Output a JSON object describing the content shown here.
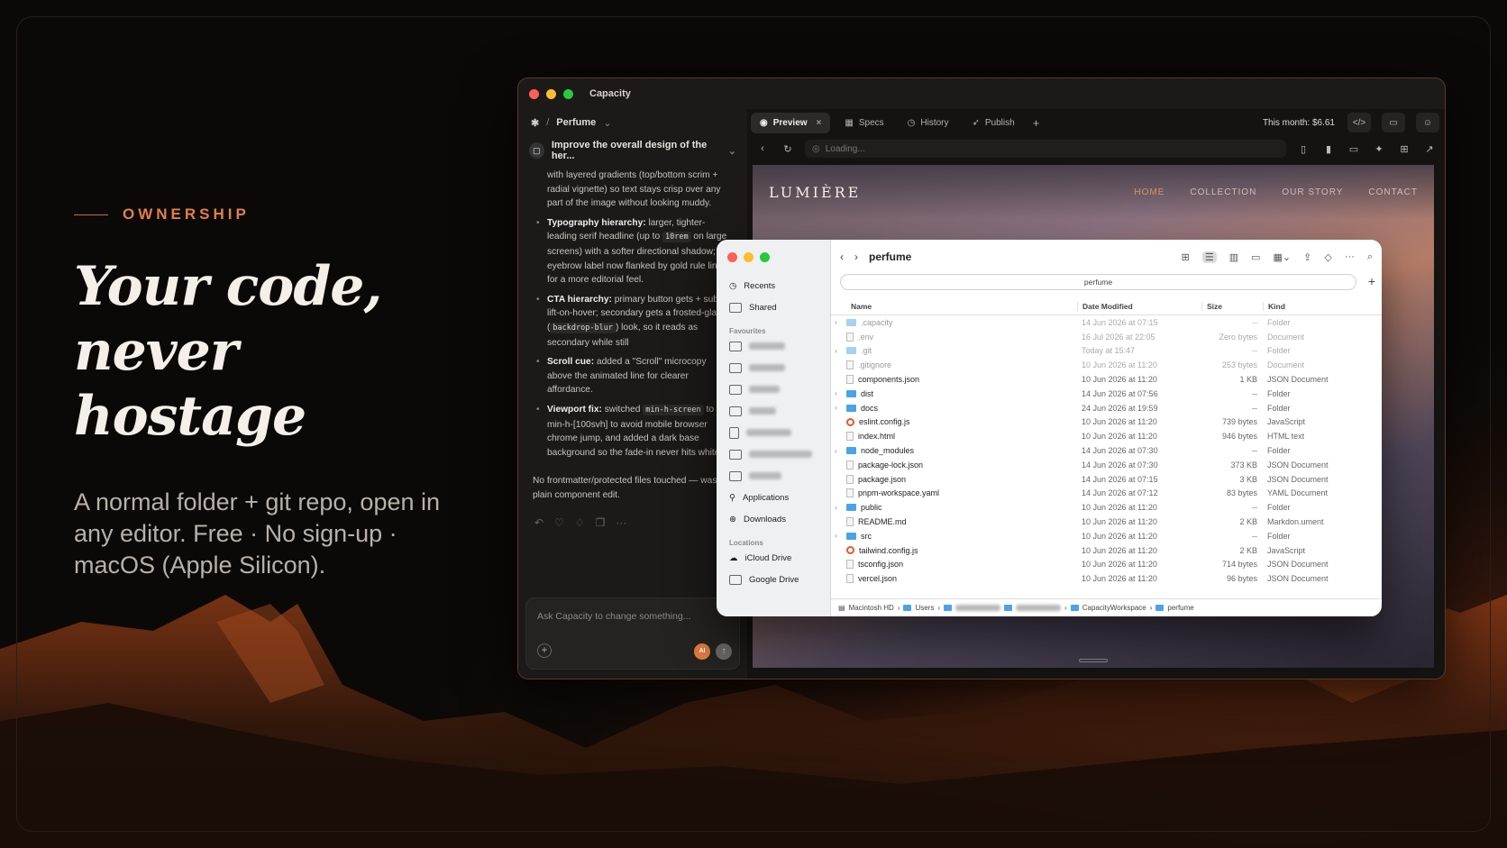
{
  "hero": {
    "eyebrow": "OWNERSHIP",
    "headline_1": "Your code,",
    "headline_2": "never hostage",
    "subtitle": "A normal folder + git repo, open in any editor. Free · No sign-up · macOS (Apple Silicon)."
  },
  "app": {
    "title": "Capacity",
    "project_sep": "/",
    "project": "Perfume",
    "thread_title": "Improve the overall design of the her...",
    "msg_intro": "with layered gradients (top/bottom scrim + radial vignette) so text stays crisp over any part of the image without looking muddy.",
    "bullets": [
      {
        "bold": "Typography hierarchy:",
        "a": " larger, tighter-leading serif headline (up to ",
        "code": "10rem",
        "b": " on large screens) with a softer directional shadow; eyebrow label now flanked by gold rule lines for a more editorial feel."
      },
      {
        "bold": "CTA hierarchy:",
        "a": " primary button gets + subtle lift-on-hover; secondary gets a frosted-glass (",
        "code": "backdrop-blur",
        "b": ") look, so it reads as secondary while still"
      },
      {
        "bold": "Scroll cue:",
        "a": " added a \"Scroll\" microcopy above the animated line for clearer affordance.",
        "code": "",
        "b": ""
      },
      {
        "bold": "Viewport fix:",
        "a": " switched ",
        "code": "min-h-screen",
        "b": " to min-h-[100svh] to avoid mobile browser chrome jump, and added a dark base background so the fade-in never hits white."
      }
    ],
    "footer_note": "No frontmatter/protected files touched — was a plain component edit.",
    "composer_placeholder": "Ask Capacity to change something...",
    "ai_badge": "AI",
    "tabs": [
      "Preview",
      "Specs",
      "History",
      "Publish"
    ],
    "cost": "This month: $6.61",
    "url_placeholder": "Loading..."
  },
  "preview": {
    "brand": "LUMIÈRE",
    "nav": [
      "HOME",
      "COLLECTION",
      "OUR STORY",
      "CONTACT"
    ]
  },
  "finder": {
    "title": "perfume",
    "path_label": "perfume",
    "sidebar": {
      "recents": "Recents",
      "shared": "Shared",
      "favourites": "Favourites",
      "applications": "Applications",
      "downloads": "Downloads",
      "locations": "Locations",
      "icloud": "iCloud Drive",
      "gdrive": "Google Drive"
    },
    "columns": [
      "Name",
      "Date Modified",
      "Size",
      "Kind"
    ],
    "rows": [
      {
        "name": ".capacity",
        "date": "14 Jun 2026 at 07:15",
        "size": "--",
        "kind": "Folder",
        "type": "folder",
        "hidden": true
      },
      {
        "name": ".env",
        "date": "16 Jul 2026 at 22:05",
        "size": "Zero bytes",
        "kind": "Document",
        "type": "doc",
        "hidden": true
      },
      {
        "name": ".git",
        "date": "Today at 15:47",
        "size": "--",
        "kind": "Folder",
        "type": "folder",
        "hidden": true
      },
      {
        "name": ".gitignore",
        "date": "10 Jun 2026 at 11:20",
        "size": "253 bytes",
        "kind": "Document",
        "type": "doc",
        "hidden": true
      },
      {
        "name": "components.json",
        "date": "10 Jun 2026 at 11:20",
        "size": "1 KB",
        "kind": "JSON Document",
        "type": "doc",
        "hidden": false
      },
      {
        "name": "dist",
        "date": "14 Jun 2026 at 07:56",
        "size": "--",
        "kind": "Folder",
        "type": "folder",
        "hidden": false
      },
      {
        "name": "docs",
        "date": "24 Jun 2026 at 19:59",
        "size": "--",
        "kind": "Folder",
        "type": "folder",
        "hidden": false
      },
      {
        "name": "eslint.config.js",
        "date": "10 Jun 2026 at 11:20",
        "size": "739 bytes",
        "kind": "JavaScript",
        "type": "js",
        "hidden": false
      },
      {
        "name": "index.html",
        "date": "10 Jun 2026 at 11:20",
        "size": "946 bytes",
        "kind": "HTML text",
        "type": "doc",
        "hidden": false
      },
      {
        "name": "node_modules",
        "date": "14 Jun 2026 at 07:30",
        "size": "--",
        "kind": "Folder",
        "type": "folder",
        "hidden": false
      },
      {
        "name": "package-lock.json",
        "date": "14 Jun 2026 at 07:30",
        "size": "373 KB",
        "kind": "JSON Document",
        "type": "doc",
        "hidden": false
      },
      {
        "name": "package.json",
        "date": "14 Jun 2026 at 07:15",
        "size": "3 KB",
        "kind": "JSON Document",
        "type": "doc",
        "hidden": false
      },
      {
        "name": "pnpm-workspace.yaml",
        "date": "14 Jun 2026 at 07:12",
        "size": "83 bytes",
        "kind": "YAML Document",
        "type": "doc",
        "hidden": false
      },
      {
        "name": "public",
        "date": "10 Jun 2026 at 11:20",
        "size": "--",
        "kind": "Folder",
        "type": "folder",
        "hidden": false
      },
      {
        "name": "README.md",
        "date": "10 Jun 2026 at 11:20",
        "size": "2 KB",
        "kind": "Markdon.ument",
        "type": "doc",
        "hidden": false
      },
      {
        "name": "src",
        "date": "10 Jun 2026 at 11:20",
        "size": "--",
        "kind": "Folder",
        "type": "folder",
        "hidden": false
      },
      {
        "name": "tailwind.config.js",
        "date": "10 Jun 2026 at 11:20",
        "size": "2 KB",
        "kind": "JavaScript",
        "type": "js",
        "hidden": false
      },
      {
        "name": "tsconfig.json",
        "date": "10 Jun 2026 at 11:20",
        "size": "714 bytes",
        "kind": "JSON Document",
        "type": "doc",
        "hidden": false
      },
      {
        "name": "vercel.json",
        "date": "10 Jun 2026 at 11:20",
        "size": "96 bytes",
        "kind": "JSON Document",
        "type": "doc",
        "hidden": false
      }
    ],
    "breadcrumb": [
      "Macintosh HD",
      "Users",
      "CapacityWorkspace",
      "perfume"
    ]
  },
  "colors": {
    "accent": "#e2804a",
    "bg": "#0b0907",
    "folder": "#4aa3e8"
  }
}
